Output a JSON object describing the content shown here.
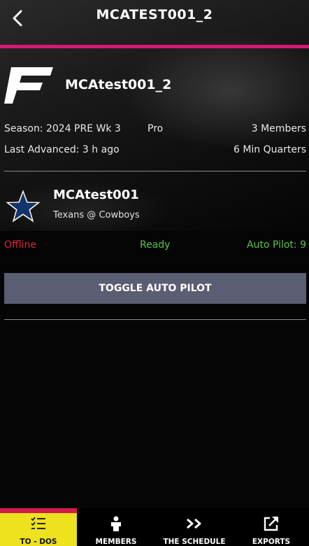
{
  "header": {
    "title": "MCATEST001_2"
  },
  "league": {
    "name": "MCAtest001_2",
    "season_label": "Season: 2024 PRE Wk 3",
    "difficulty": "Pro",
    "members": "3 Members",
    "last_advanced": "Last Advanced: 3 h ago",
    "quarter_length": "6 Min Quarters"
  },
  "team": {
    "user_name": "MCAtest001",
    "matchup": "Texans @ Cowboys",
    "status": {
      "offline": "Offline",
      "ready": "Ready",
      "auto_pilot": "Auto Pilot: 9"
    },
    "toggle_label": "TOGGLE AUTO PILOT"
  },
  "tabs": [
    {
      "label": "TO - DOS",
      "icon": "checklist-icon",
      "active": true
    },
    {
      "label": "MEMBERS",
      "icon": "person-icon",
      "active": false
    },
    {
      "label": "THE SCHEDULE",
      "icon": "double-chevron-right-icon",
      "active": false
    },
    {
      "label": "EXPORTS",
      "icon": "export-icon",
      "active": false
    }
  ],
  "colors": {
    "accent_magenta": "#d9177a",
    "offline_red": "#e0223c",
    "ready_green": "#5cc24a",
    "button_gray": "#5a5e72",
    "tab_active_yellow": "#ede21d",
    "tab_active_stripe": "#d11a4c"
  }
}
